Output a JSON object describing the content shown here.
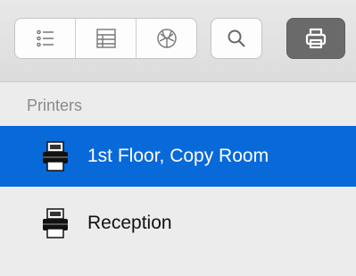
{
  "toolbar": {
    "view_buttons": [
      {
        "name": "list-view",
        "icon": "list-icon"
      },
      {
        "name": "column-view",
        "icon": "columns-icon"
      },
      {
        "name": "network-view",
        "icon": "globe-icon"
      }
    ],
    "search_icon": "magnifier-icon",
    "print_icon": "printer-icon"
  },
  "sidebar": {
    "section_title": "Printers",
    "items": [
      {
        "label": "1st Floor, Copy Room",
        "selected": true
      },
      {
        "label": "Reception",
        "selected": false
      }
    ]
  },
  "colors": {
    "selection": "#0869d9",
    "toolbar_bg": "#e2e2e2",
    "sidebar_bg": "#ececec",
    "active_button": "#6a6a6a"
  }
}
